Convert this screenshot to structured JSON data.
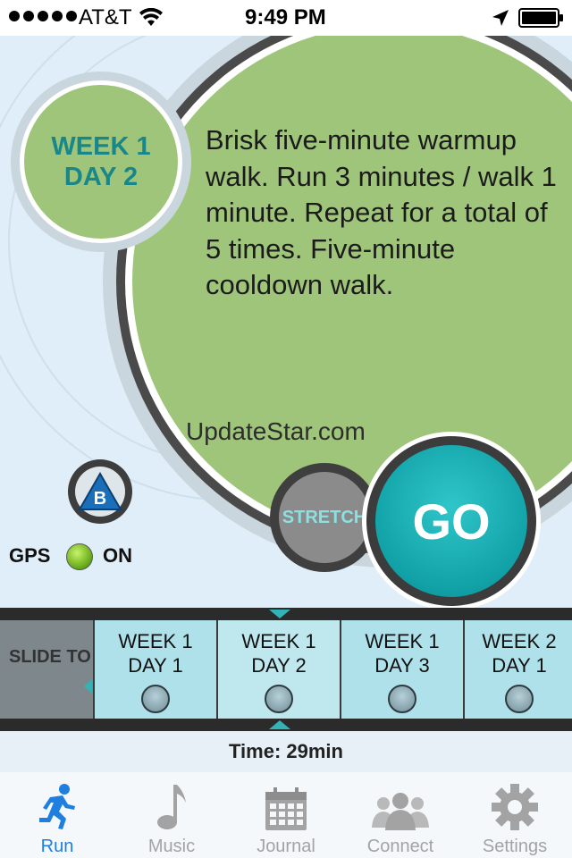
{
  "status_bar": {
    "carrier": "AT&T",
    "time": "9:49 PM",
    "icons": [
      "signal-dots-icon",
      "wifi-icon",
      "location-arrow-icon",
      "battery-icon"
    ]
  },
  "workout": {
    "week_line1": "WEEK 1",
    "week_line2": "DAY 2",
    "description": "Brisk five-minute warmup walk. Run 3 minutes / walk 1 minute. Repeat for a total of 5 times. Five-minute cooldown walk.",
    "watermark": "UpdateStar.com"
  },
  "buttons": {
    "stretch": "STRETCH",
    "go": "GO",
    "b_badge": "B"
  },
  "gps": {
    "label": "GPS",
    "state": "ON"
  },
  "slider": {
    "label": "SLIDE TO",
    "items": [
      {
        "line1": "WEEK 1",
        "line2": "DAY 1"
      },
      {
        "line1": "WEEK 1",
        "line2": "DAY 2"
      },
      {
        "line1": "WEEK 1",
        "line2": "DAY 3"
      },
      {
        "line1": "WEEK 2",
        "line2": "DAY 1"
      }
    ]
  },
  "time_label": "Time: 29min",
  "tabs": [
    {
      "label": "Run",
      "icon": "runner-icon",
      "active": true
    },
    {
      "label": "Music",
      "icon": "music-note-icon",
      "active": false
    },
    {
      "label": "Journal",
      "icon": "calendar-icon",
      "active": false
    },
    {
      "label": "Connect",
      "icon": "people-icon",
      "active": false
    },
    {
      "label": "Settings",
      "icon": "gear-icon",
      "active": false
    }
  ],
  "colors": {
    "accent_teal": "#11a1a6",
    "green": "#9fc57a",
    "tab_active": "#1e7fe0",
    "tab_inactive": "#a3a3a3"
  }
}
